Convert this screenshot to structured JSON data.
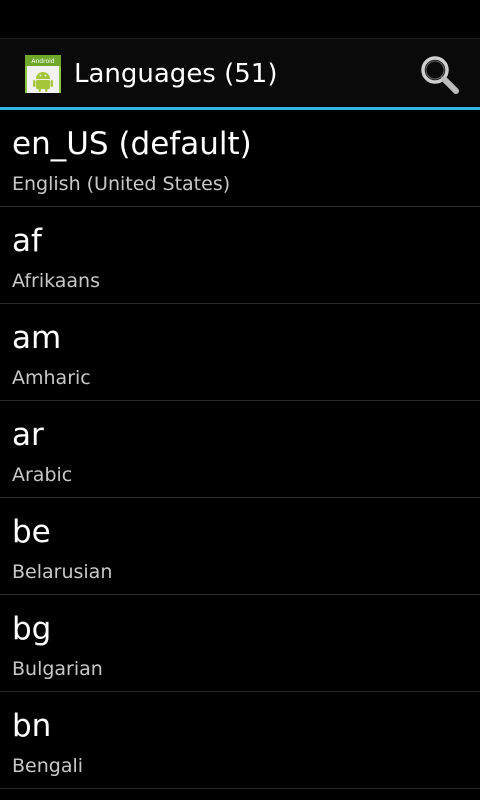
{
  "app_icon": {
    "label": "Android",
    "icon": "android-robot-icon"
  },
  "header": {
    "title": "Languages (51)",
    "search_icon": "search-icon"
  },
  "colors": {
    "background": "#000000",
    "accent": "#33b5e5",
    "primary_text": "#ffffff",
    "secondary_text": "#c8c8c8"
  },
  "languages": [
    {
      "code": "en_US (default)",
      "name": "English (United States)"
    },
    {
      "code": "af",
      "name": "Afrikaans"
    },
    {
      "code": "am",
      "name": "Amharic"
    },
    {
      "code": "ar",
      "name": "Arabic"
    },
    {
      "code": "be",
      "name": "Belarusian"
    },
    {
      "code": "bg",
      "name": "Bulgarian"
    },
    {
      "code": "bn",
      "name": "Bengali"
    }
  ]
}
